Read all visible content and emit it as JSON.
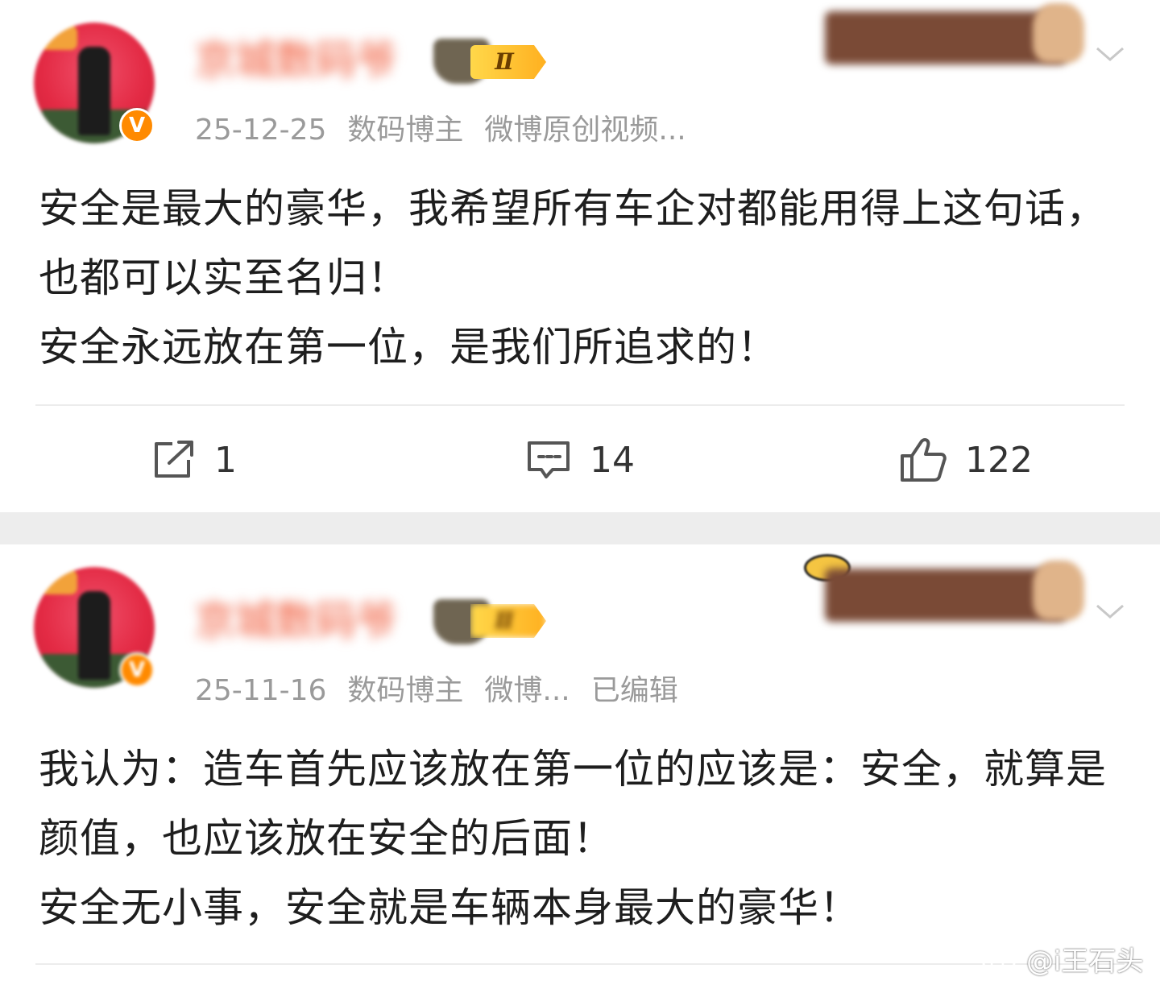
{
  "posts": [
    {
      "username": "京城数码爷",
      "level_badge": "Ⅱ",
      "verified_mark": "V",
      "date": "25-12-25",
      "tags": [
        "数码博主",
        "微博原创视频..."
      ],
      "edited": "",
      "content": "安全是最大的豪华，我希望所有车企对都能用得上这句话，也都可以实至名归！\n安全永远放在第一位，是我们所追求的！",
      "actions": {
        "repost_count": "1",
        "comment_count": "14",
        "like_count": "122"
      }
    },
    {
      "username": "京城数码爷",
      "level_badge": "Ⅱ",
      "verified_mark": "V",
      "date": "25-11-16",
      "tags": [
        "数码博主",
        "微博..."
      ],
      "edited": "已编辑",
      "content": "我认为：造车首先应该放在第一位的应该是：安全，就算是颜值，也应该放在安全的后面！\n安全无小事，安全就是车辆本身最大的豪华！"
    }
  ],
  "watermark": "@i王石头",
  "icons": {
    "repost": "repost-icon",
    "comment": "comment-icon",
    "like": "thumbs-up-icon",
    "more": "chevron-down-icon",
    "weibo": "weibo-logo-icon"
  },
  "colors": {
    "separator": "#ededed",
    "meta_text": "#9a9a9a",
    "verified": "#ff8a00",
    "level_badge": "#ffc83a"
  }
}
